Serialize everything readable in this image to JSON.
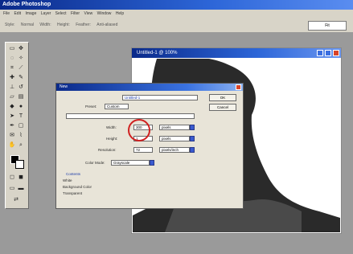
{
  "app": {
    "title": "Adobe Photoshop"
  },
  "menubar": {
    "items": [
      "File",
      "Edit",
      "Image",
      "Layer",
      "Select",
      "Filter",
      "View",
      "Window",
      "Help"
    ]
  },
  "optionsbar": {
    "segments": [
      "Style:",
      "Normal",
      "Width:",
      "Height:",
      "Feather:",
      "Anti-aliased"
    ],
    "box_value": "Fit"
  },
  "image_window": {
    "title": "Untitled-1 @ 100%"
  },
  "dialog": {
    "title": "New",
    "name_value": "Untitled-1",
    "preset_label": "Preset:",
    "preset_value": "Custom",
    "width_label": "Width:",
    "width_value": "300",
    "width_unit": "pixels",
    "height_label": "Height:",
    "height_value": "1",
    "height_unit": "pixels",
    "resolution_label": "Resolution:",
    "resolution_value": "72",
    "resolution_unit": "pixels/inch",
    "mode_label": "Color Mode:",
    "mode_value": "Grayscale",
    "ok_label": "OK",
    "cancel_label": "Cancel",
    "contents_label": "Contents",
    "contents_options": [
      "White",
      "Background Color",
      "Transparent"
    ]
  }
}
